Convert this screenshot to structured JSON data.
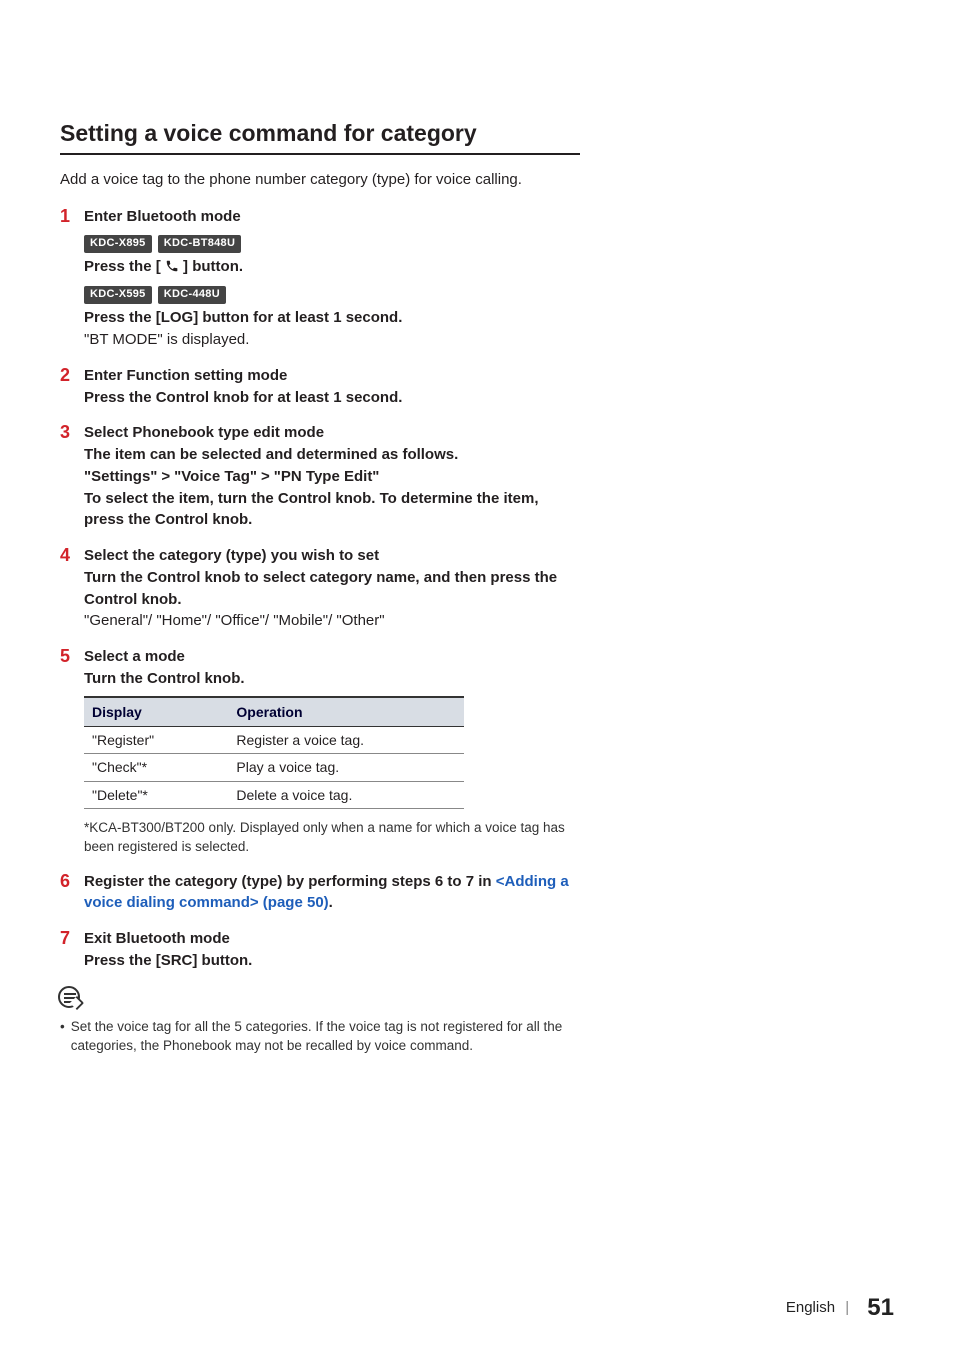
{
  "section": {
    "title": "Setting a voice command for category",
    "intro": "Add a voice tag to the phone number category (type) for voice calling."
  },
  "steps": [
    {
      "num": "1",
      "title": "Enter Bluetooth mode",
      "badges1": [
        "KDC-X895",
        "KDC-BT848U"
      ],
      "sub1_pre": "Press the [",
      "sub1_post": "] button.",
      "badges2": [
        "KDC-X595",
        "KDC-448U"
      ],
      "sub2": "Press the [LOG] button for at least 1 second.",
      "desc": "\"BT MODE\" is displayed."
    },
    {
      "num": "2",
      "title": "Enter Function setting mode",
      "sub": "Press the Control knob for at least 1 second."
    },
    {
      "num": "3",
      "title": "Select Phonebook type edit mode",
      "sub1": "The item can be selected and determined as follows.",
      "path": [
        "\"Settings\"",
        "\"Voice Tag\"",
        "\"PN Type Edit\""
      ],
      "sub2": "To select the item, turn the Control knob. To determine the item, press the Control knob."
    },
    {
      "num": "4",
      "title": "Select the category (type) you wish to set",
      "sub": "Turn the Control knob to select category name, and then press the Control knob.",
      "desc": "\"General\"/ \"Home\"/ \"Office\"/ \"Mobile\"/ \"Other\""
    },
    {
      "num": "5",
      "title": "Select a mode",
      "sub": "Turn the Control knob.",
      "table": {
        "headers": [
          "Display",
          "Operation"
        ],
        "rows": [
          [
            "\"Register\"",
            "Register a voice tag."
          ],
          [
            "\"Check\"*",
            "Play a voice tag."
          ],
          [
            "\"Delete\"*",
            "Delete a voice tag."
          ]
        ]
      },
      "note": "*KCA-BT300/BT200 only. Displayed only when a name for which a voice tag has been registered is selected."
    },
    {
      "num": "6",
      "title_pre": "Register the category (type) by performing steps 6 to 7 in ",
      "link": "<Adding a voice dialing command> (page 50)",
      "title_post": "."
    },
    {
      "num": "7",
      "title": "Exit Bluetooth mode",
      "sub": "Press the [SRC] button."
    }
  ],
  "endnote": "Set the voice tag for all the 5 categories.  If the voice tag is not registered for all the categories, the Phonebook may not be recalled by voice command.",
  "footer": {
    "lang": "English",
    "page": "51"
  }
}
